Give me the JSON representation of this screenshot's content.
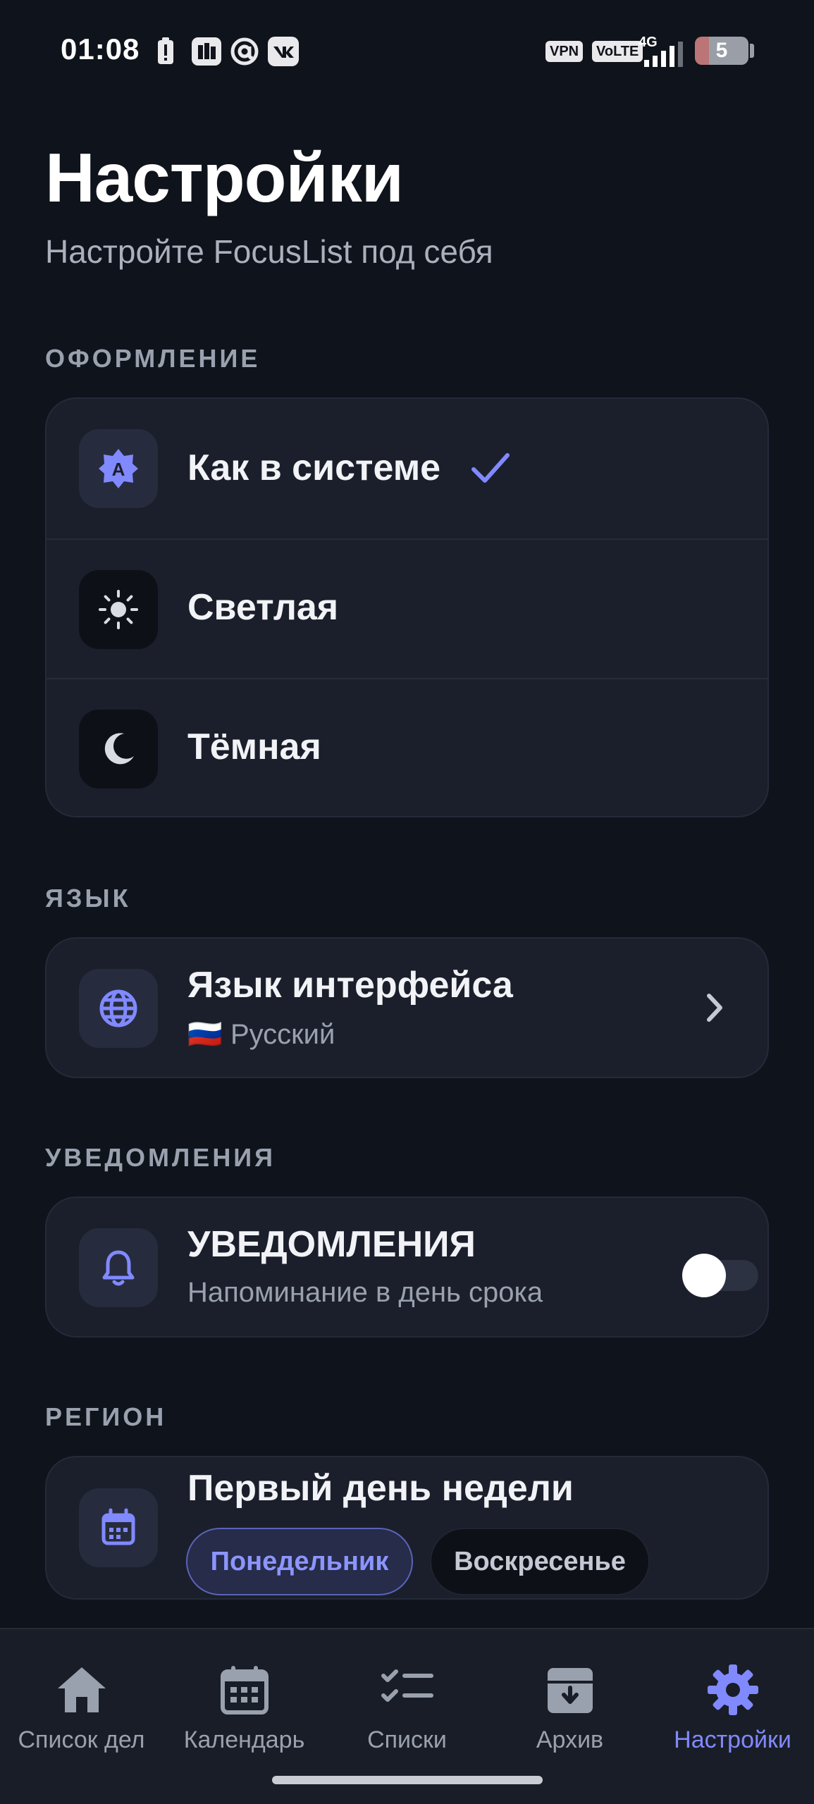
{
  "status_bar": {
    "time": "01:08",
    "vpn": "VPN",
    "volte": "VoLTE",
    "network": "4G",
    "battery": "5",
    "icons": [
      "battery-alert-icon",
      "app-icon",
      "at-icon",
      "vk-icon",
      "signal-icon"
    ]
  },
  "header": {
    "title": "Настройки",
    "subtitle": "Настройте FocusList под себя"
  },
  "appearance": {
    "section": "ОФОРМЛЕНИЕ",
    "options": [
      {
        "label": "Как в системе",
        "icon": "auto-theme-icon",
        "selected": true
      },
      {
        "label": "Светлая",
        "icon": "sun-icon",
        "selected": false
      },
      {
        "label": "Тёмная",
        "icon": "moon-icon",
        "selected": false
      }
    ]
  },
  "language": {
    "section": "ЯЗЫК",
    "label": "Язык интерфейса",
    "flag": "🇷🇺",
    "value": "Русский",
    "icon": "globe-icon"
  },
  "notifications": {
    "section": "УВЕДОМЛЕНИЯ",
    "label": "УВЕДОМЛЕНИЯ",
    "sub": "Напоминание в день срока",
    "enabled": false,
    "icon": "bell-icon"
  },
  "region": {
    "section": "РЕГИОН",
    "label": "Первый день недели",
    "icon": "calendar-icon",
    "options": [
      {
        "label": "Понедельник",
        "selected": true
      },
      {
        "label": "Воскресенье",
        "selected": false
      }
    ]
  },
  "nav": {
    "items": [
      {
        "label": "Список дел",
        "icon": "home-icon"
      },
      {
        "label": "Календарь",
        "icon": "calendar-icon"
      },
      {
        "label": "Списки",
        "icon": "checklist-icon"
      },
      {
        "label": "Архив",
        "icon": "archive-icon"
      },
      {
        "label": "Настройки",
        "icon": "gear-icon",
        "active": true
      }
    ]
  },
  "colors": {
    "background": "#0f131b",
    "card": "#1b1f2b",
    "accent": "#8189ff",
    "muted": "#9aa1ae"
  }
}
